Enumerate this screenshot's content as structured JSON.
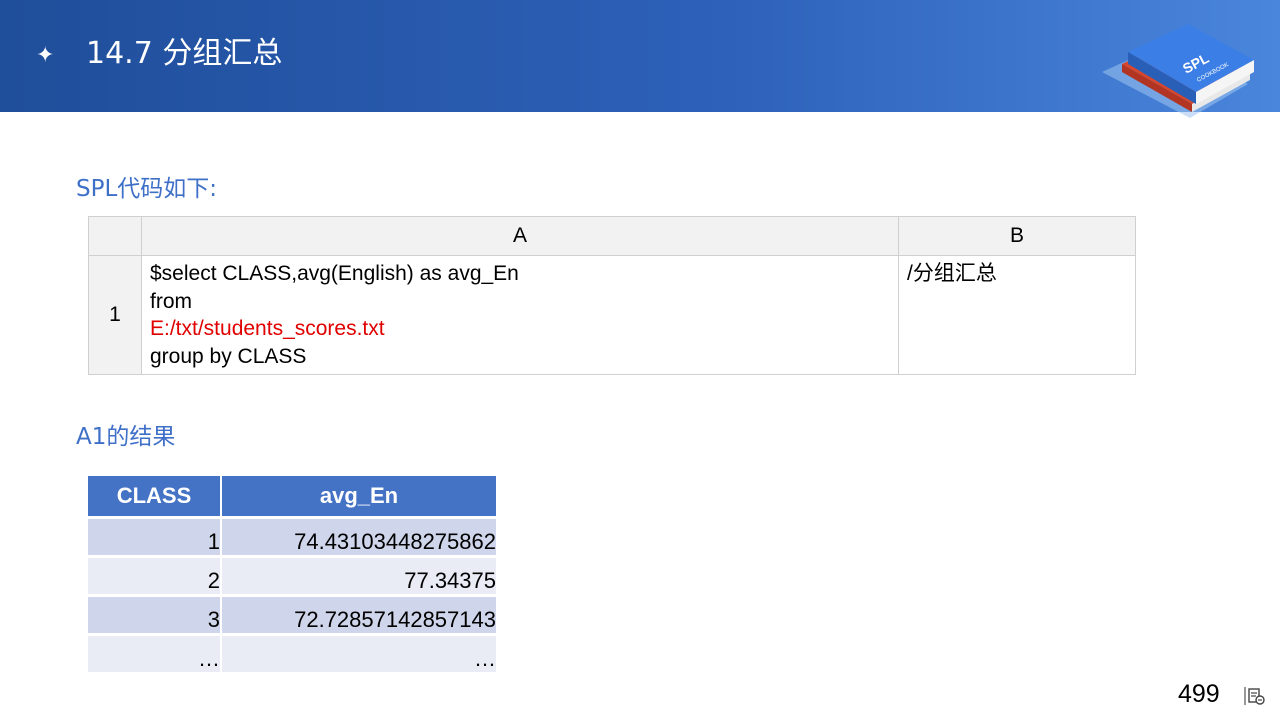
{
  "header": {
    "star_glyph": "✦",
    "title": "14.7 分组汇总",
    "logo_text": "SPL",
    "logo_subtext": "COOKBOOK"
  },
  "section1": {
    "label": "SPL代码如下:"
  },
  "code_grid": {
    "col_a": "A",
    "col_b": "B",
    "row_no": "1",
    "code_lines": [
      "$select CLASS,avg(English)  as avg_En",
      "from",
      "E:/txt/students_scores.txt",
      "group by  CLASS"
    ],
    "comment": "/分组汇总"
  },
  "section2": {
    "label": "A1的结果"
  },
  "result_table": {
    "headers": [
      "CLASS",
      "avg_En"
    ],
    "rows": [
      [
        "1",
        "74.43103448275862"
      ],
      [
        "2",
        "77.34375"
      ],
      [
        "3",
        "72.72857142857143"
      ],
      [
        "…",
        "…"
      ]
    ]
  },
  "footer": {
    "page_number": "499",
    "icon": "slide-notes-icon"
  },
  "colors": {
    "header_start": "#1f4e9a",
    "header_end": "#4a86dc",
    "accent": "#3f70c8",
    "table_header": "#4472c4",
    "file_path": "#e00000"
  }
}
